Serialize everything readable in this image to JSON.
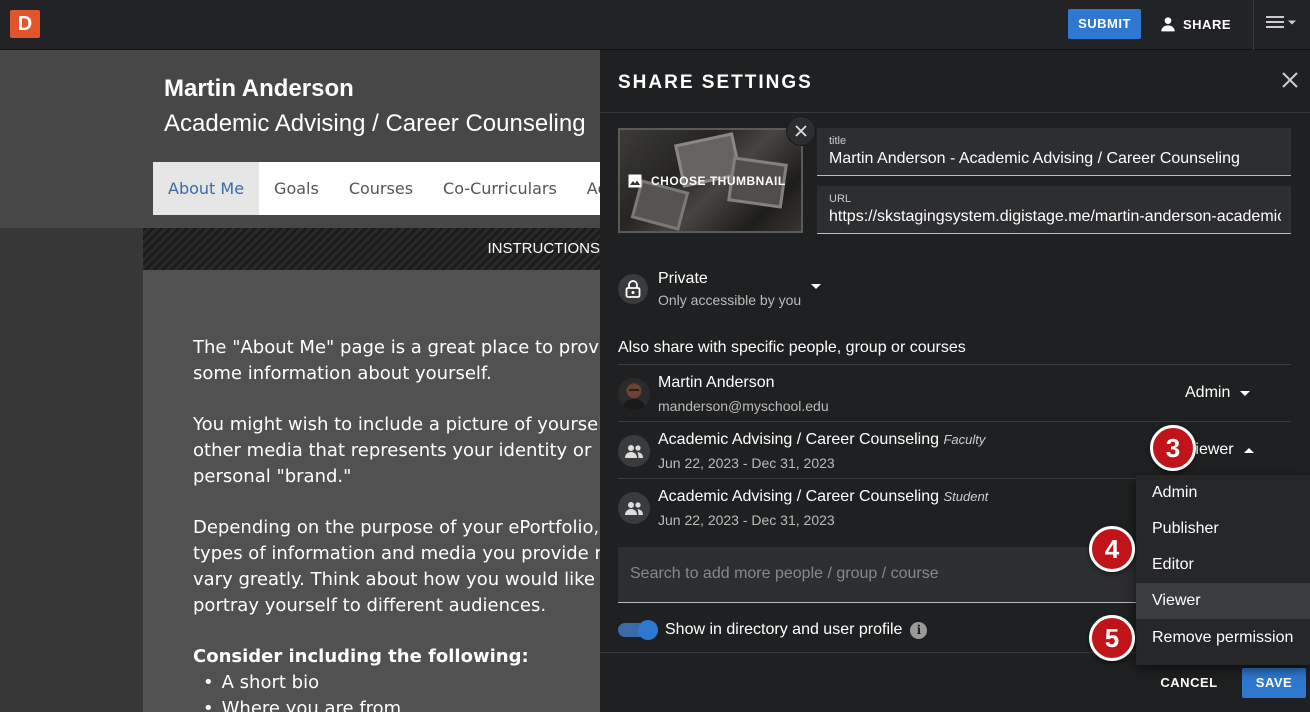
{
  "topbar": {
    "logo_letter": "D",
    "submit_label": "SUBMIT",
    "share_label": "SHARE"
  },
  "background": {
    "profile_name": "Martin Anderson",
    "profile_subtitle": "Academic Advising / Career Counseling",
    "nav_tabs": [
      {
        "label": "About Me",
        "active": true
      },
      {
        "label": "Goals",
        "active": false
      },
      {
        "label": "Courses",
        "active": false
      },
      {
        "label": "Co-Curriculars",
        "active": false
      },
      {
        "label": "Ach",
        "active": false
      }
    ],
    "instructions_label": "INSTRUCTIONS",
    "content": {
      "p1_line1": "The \"About Me\" page is a great place to provide",
      "p1_line2": "some information about yourself.",
      "p2_line1": "You might wish to include a picture of yourself or",
      "p2_line2": "other media that represents your identity or",
      "p2_line3": "personal \"brand.\"",
      "p3_line1": "Depending on the purpose of your ePortfolio, the",
      "p3_line2": "types of information and media you provide may",
      "p3_line3": "vary greatly. Think about how you would like to",
      "p3_line4": "portray yourself to different audiences.",
      "consider_heading": "Consider including the following:",
      "bullets": [
        "A short bio",
        "Where you are from"
      ]
    }
  },
  "panel": {
    "title": "SHARE SETTINGS",
    "thumbnail_label": "CHOOSE THUMBNAIL",
    "title_field": {
      "label": "title",
      "value": "Martin Anderson - Academic Advising / Career Counseling"
    },
    "url_field": {
      "label": "URL",
      "value": "https://skstagingsystem.digistage.me/martin-anderson-academic-advising"
    },
    "privacy": {
      "main": "Private",
      "sub": "Only accessible by you"
    },
    "also_share_label": "Also share with specific people, group or courses",
    "share_rows": [
      {
        "name": "Martin Anderson",
        "tag": "",
        "sub": "manderson@myschool.edu",
        "role": "Admin",
        "type": "person"
      },
      {
        "name": "Academic Advising / Career Counseling",
        "tag": "Faculty",
        "sub": "Jun 22, 2023 - Dec 31, 2023",
        "role": "Viewer",
        "type": "group"
      },
      {
        "name": "Academic Advising / Career Counseling",
        "tag": "Student",
        "sub": "Jun 22, 2023 - Dec 31, 2023",
        "role": "",
        "type": "group"
      }
    ],
    "search_placeholder": "Search to add more people / group / course",
    "directory_toggle": {
      "label": "Show in directory and user profile",
      "on": true
    },
    "cancel_label": "CANCEL",
    "save_label": "SAVE"
  },
  "role_menu": {
    "items": [
      "Admin",
      "Publisher",
      "Editor",
      "Viewer",
      "Remove permission"
    ],
    "selected": "Viewer"
  },
  "callouts": [
    "3",
    "4",
    "5"
  ],
  "colors": {
    "accent": "#2f78d1",
    "logo": "#e0552b",
    "callout": "#c0141a",
    "panel_bg": "#1f2021"
  }
}
